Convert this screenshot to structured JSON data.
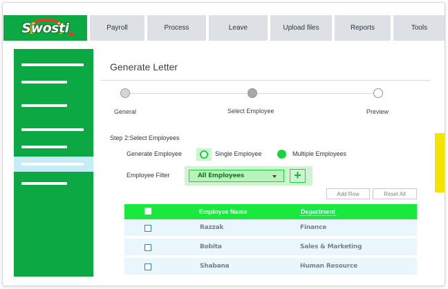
{
  "logo": {
    "text": "Swosti"
  },
  "nav": {
    "tabs": [
      {
        "label": "Payroll"
      },
      {
        "label": "Process"
      },
      {
        "label": "Leave"
      },
      {
        "label": "Upload files"
      },
      {
        "label": "Reports"
      },
      {
        "label": "Tools"
      }
    ]
  },
  "page": {
    "title": "Generate Letter"
  },
  "stepper": {
    "steps": [
      {
        "label": "General",
        "state": "done"
      },
      {
        "label": "Select Employee",
        "state": "current"
      },
      {
        "label": "Preview",
        "state": "pending"
      }
    ]
  },
  "form": {
    "section_heading": "Step 2:Select Employees",
    "generate_label": "Generate Employee",
    "option_single": "Single Employee",
    "option_multiple": "Multiple Employees",
    "selected_option": "Multiple Employees",
    "filter_label": "Employee Filter",
    "filter_value": "All Employees",
    "add_row": "Add Row",
    "reset_all": "Reset All"
  },
  "table": {
    "columns": [
      "",
      "Employee Name",
      "Department"
    ],
    "rows": [
      {
        "name": "Razzak",
        "department": "Finance"
      },
      {
        "name": "Bobita",
        "department": "Sales & Marketing"
      },
      {
        "name": "Shabana",
        "department": "Human Resource"
      }
    ]
  },
  "colors": {
    "brand_green": "#0ba843",
    "accent_green": "#19e83c",
    "tab_bg": "#dde1e5",
    "row_bg": "#e9f7fc",
    "scrollbar": "#f5e400"
  },
  "icons": {
    "dropdown": "caret-down-icon",
    "add": "plus-icon"
  }
}
